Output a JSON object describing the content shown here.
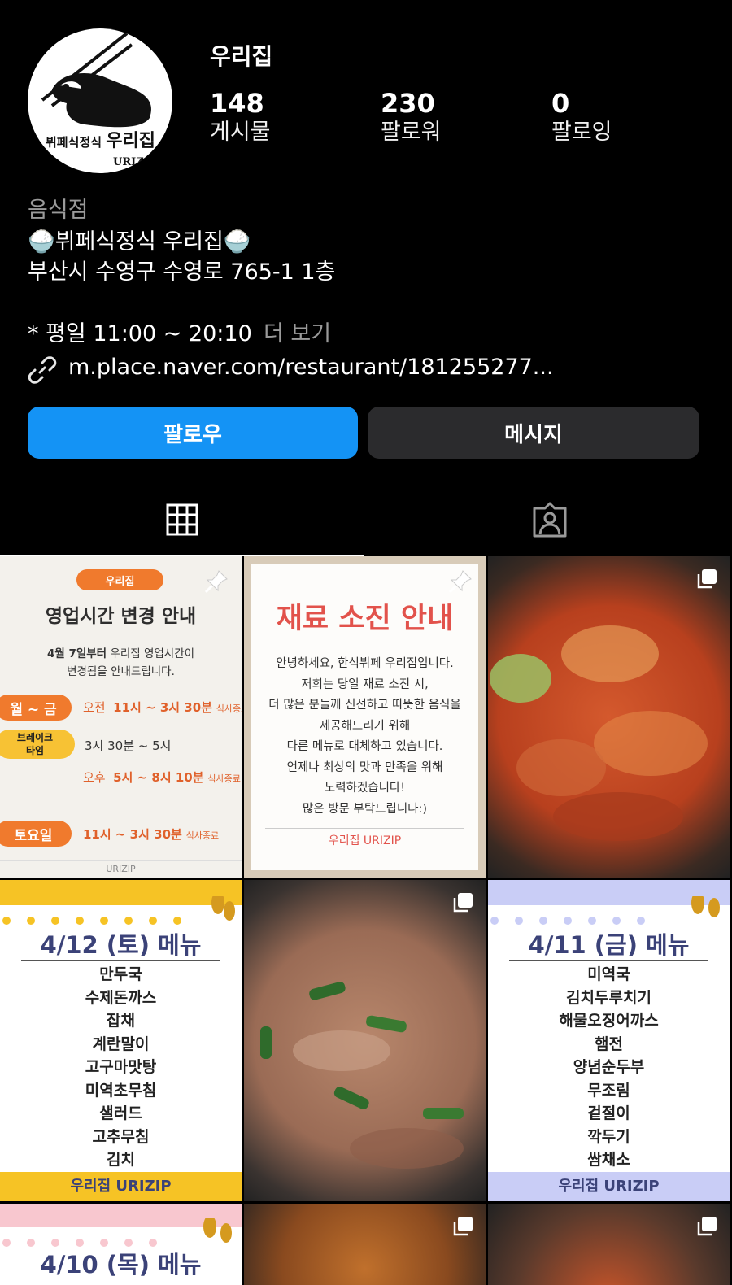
{
  "profile": {
    "username": "우리집",
    "avatar": {
      "logo_title": "뷔페식정식 우리집",
      "logo_sub": "URIZIP"
    },
    "stats": [
      {
        "value": "148",
        "label": "게시물"
      },
      {
        "value": "230",
        "label": "팔로워"
      },
      {
        "value": "0",
        "label": "팔로잉"
      }
    ],
    "category": "음식점",
    "bio_line1": "🍚뷔페식정식 우리집🍚",
    "bio_line2": "부산시 수영구 수영로 765-1 1층",
    "hours": "* 평일 11:00 ~ 20:10",
    "more_label": "더 보기",
    "link": "m.place.naver.com/restaurant/181255277..."
  },
  "buttons": {
    "follow": "팔로우",
    "message": "메시지"
  },
  "tabs": {
    "grid_icon": "grid-icon",
    "tagged_icon": "tagged-person-icon"
  },
  "posts": {
    "hours_notice": {
      "badge": "우리집",
      "title": "영업시간 변경 안내",
      "desc_bold": "4월 7일부터",
      "desc_rest": " 우리집 영업시간이",
      "desc2": "변경됨을 안내드립니다.",
      "weekday_label": "월 ~ 금",
      "weekday_am": "오전",
      "weekday_time": "11시 ~ 3시 30분",
      "meal_end": "식사종료",
      "break_label1": "브레이크",
      "break_label2": "타임",
      "break_time": "3시 30분 ~ 5시",
      "weekday_pm": "오후",
      "weekday_pm_time": "5시 ~ 8시 10분",
      "meal_end2": "식사종료",
      "sat_label": "토요일",
      "sat_time": "11시 ~ 3시 30분",
      "sat_end": "식사종료",
      "footer": "URIZIP"
    },
    "sold_out": {
      "title": "재료 소진 안내",
      "lines": [
        "안녕하세요, 한식뷔페 우리집입니다.",
        "저희는 당일 재료 소진 시,",
        "더 많은 분들께 신선하고 따뜻한 음식을",
        "제공해드리기 위해",
        "다른 메뉴로 대체하고 있습니다.",
        "언제나 최상의 맛과 만족을 위해",
        "노력하겠습니다!",
        "많은 방문 부탁드립니다:)"
      ],
      "footer": "우리집 URIZIP"
    },
    "menu_0412": {
      "title": "4/12 (토) 메뉴",
      "items": [
        "만두국",
        "수제돈까스",
        "잡채",
        "계란말이",
        "고구마맛탕",
        "미역초무침",
        "샐러드",
        "고추무침",
        "김치"
      ],
      "footer": "우리집 URIZIP",
      "accent": "#f6c325"
    },
    "menu_0411": {
      "title": "4/11 (금) 메뉴",
      "items": [
        "미역국",
        "김치두루치기",
        "해물오징어까스",
        "햄전",
        "양념순두부",
        "무조림",
        "겉절이",
        "깍두기",
        "쌈채소"
      ],
      "footer": "우리집 URIZIP",
      "accent": "#c9cdf6"
    },
    "menu_0410": {
      "title": "4/10 (목) 메뉴",
      "accent": "#f8c7cf"
    }
  },
  "colors": {
    "follow": "#1493f5",
    "message_bg": "#2b2b2d",
    "orange": "#f07a2d",
    "title_navy": "#3b4278",
    "red_title": "#e2524b"
  }
}
